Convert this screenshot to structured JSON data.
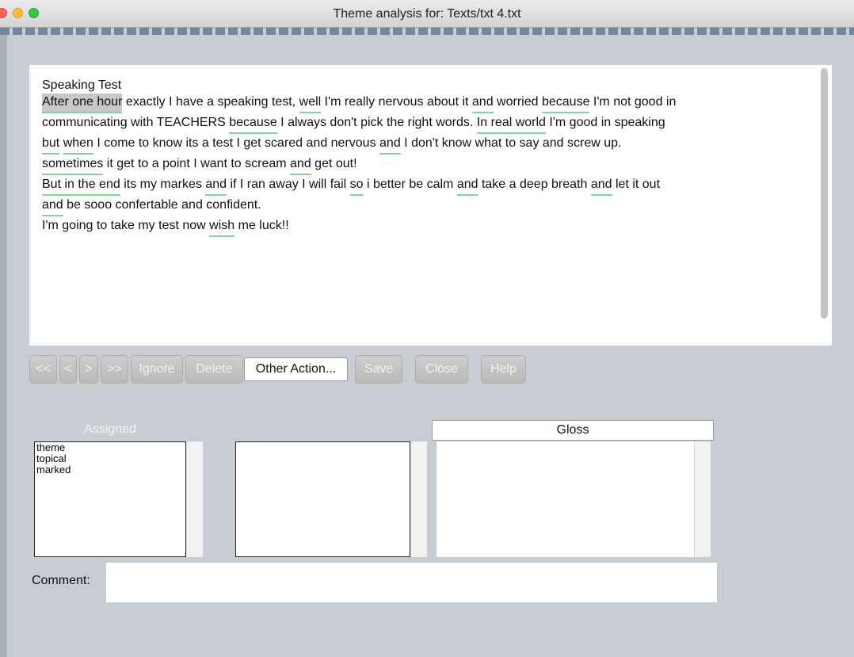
{
  "window": {
    "title": "Theme analysis for: Texts/txt 4.txt"
  },
  "text": {
    "lines": [
      [
        {
          "t": "Speaking Test"
        }
      ],
      [
        {
          "t": "After one hour",
          "hl": true,
          "ul": true
        },
        {
          "t": " exactly I have a speaking test, "
        },
        {
          "t": "well",
          "ul": true
        },
        {
          "t": " I'm really nervous about it "
        },
        {
          "t": "and",
          "ul": true
        },
        {
          "t": " worried "
        },
        {
          "t": "because",
          "ul": true
        },
        {
          "t": " I'm not good in"
        }
      ],
      [
        {
          "t": "communicating with TEACHERS "
        },
        {
          "t": "because",
          "ul": true
        },
        {
          "t": " I always don't pick the right words. "
        },
        {
          "t": "In real world",
          "ul": true
        },
        {
          "t": " I'm good in speaking"
        }
      ],
      [
        {
          "t": "but",
          "ul": true
        },
        {
          "t": " "
        },
        {
          "t": "when",
          "ul": true
        },
        {
          "t": " I come to know its a test I get scared and nervous "
        },
        {
          "t": "and",
          "ul": true
        },
        {
          "t": " I don't know what to say and screw up."
        }
      ],
      [
        {
          "t": "sometimes",
          "ul": true
        },
        {
          "t": " it get to a point I want to scream "
        },
        {
          "t": "and",
          "ul": true
        },
        {
          "t": " get out!"
        }
      ],
      [
        {
          "t": "But in the end",
          "ul": true
        },
        {
          "t": " its my markes "
        },
        {
          "t": "and",
          "ul": true
        },
        {
          "t": " if I ran away I will fail "
        },
        {
          "t": "so",
          "ul": true
        },
        {
          "t": " i better be calm "
        },
        {
          "t": "and",
          "ul": true
        },
        {
          "t": " take a deep breath "
        },
        {
          "t": "and",
          "ul": true
        },
        {
          "t": " let it out"
        }
      ],
      [
        {
          "t": "and",
          "ul": true
        },
        {
          "t": " be sooo confertable and confident."
        }
      ],
      [
        {
          "t": "I'm going to take my test now "
        },
        {
          "t": "wish",
          "ul": true
        },
        {
          "t": " me luck!!"
        }
      ]
    ]
  },
  "toolbar": {
    "first_label": "<<",
    "prev_label": "<",
    "next_label": ">",
    "last_label": ">>",
    "ignore_label": "Ignore",
    "delete_label": "Delete",
    "other_action_label": "Other Action...",
    "save_label": "Save",
    "close_label": "Close",
    "help_label": "Help"
  },
  "assigned": {
    "header": "Assigned",
    "items": [
      "theme",
      "topical",
      "marked"
    ]
  },
  "gloss": {
    "header": "Gloss"
  },
  "comment": {
    "label": "Comment:",
    "value": ""
  },
  "colors": {
    "underline": "#7fd99a",
    "highlight": "#c8c8c8",
    "background": "#c7cdd2"
  }
}
